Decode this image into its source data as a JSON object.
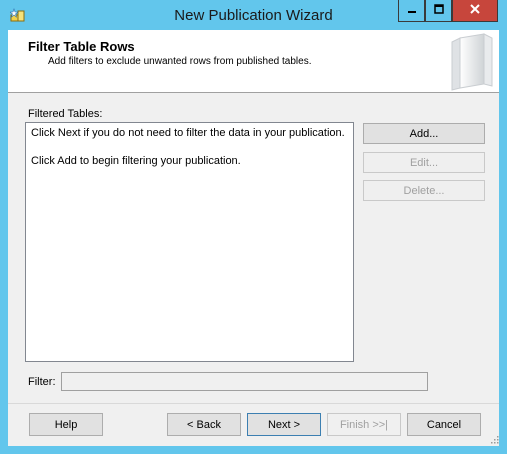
{
  "window": {
    "title": "New Publication Wizard",
    "controls": {
      "minimize": "minimize",
      "maximize": "maximize",
      "close": "close"
    },
    "colors": {
      "frame": "#62c6ec",
      "close_button": "#c7463c"
    }
  },
  "header": {
    "title": "Filter Table Rows",
    "subtitle": "Add filters to exclude unwanted rows from published tables."
  },
  "filtered_tables": {
    "label": "Filtered Tables:",
    "messages": [
      "Click Next if you do not need to filter the data in your publication.",
      "Click Add to begin filtering your publication."
    ]
  },
  "side_buttons": {
    "add": "Add...",
    "edit": "Edit...",
    "delete": "Delete..."
  },
  "filter": {
    "label": "Filter:",
    "value": ""
  },
  "nav_buttons": {
    "help": "Help",
    "back": "< Back",
    "next": "Next >",
    "finish": "Finish >>|",
    "cancel": "Cancel"
  },
  "icons": {
    "app": "wizard-app-icon",
    "header": "publication-book-icon",
    "grip": "resize-grip-icon"
  }
}
